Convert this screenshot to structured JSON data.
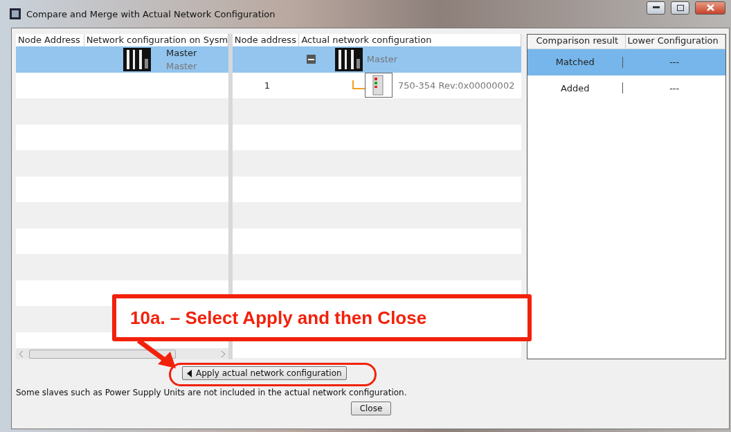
{
  "window": {
    "title": "Compare and Merge with Actual Network Configuration"
  },
  "left_table": {
    "columns": [
      "Node Address",
      "Network configuration on Sysm"
    ],
    "rows": [
      {
        "name": "Master",
        "subname": "Master",
        "selected": true
      }
    ]
  },
  "middle_table": {
    "columns": [
      "Node address",
      "Actual network configuration"
    ],
    "rows": [
      {
        "kind": "master",
        "name": "Master",
        "selected": true,
        "expanded": true
      },
      {
        "kind": "slave",
        "address": "1",
        "name": "750-354 Rev:0x00000002",
        "selected": false
      }
    ]
  },
  "right_table": {
    "columns": [
      "Comparison result",
      "Lower Configuration"
    ],
    "rows": [
      {
        "result": "Matched",
        "lower": "---",
        "selected": true
      },
      {
        "result": "Added",
        "lower": "---",
        "selected": false
      }
    ]
  },
  "apply_button": "Apply actual network configuration",
  "note": "Some slaves such as Power Supply Units are not included in the actual network configuration.",
  "close_button": "Close",
  "callout": "10a. – Select Apply and then Close"
}
